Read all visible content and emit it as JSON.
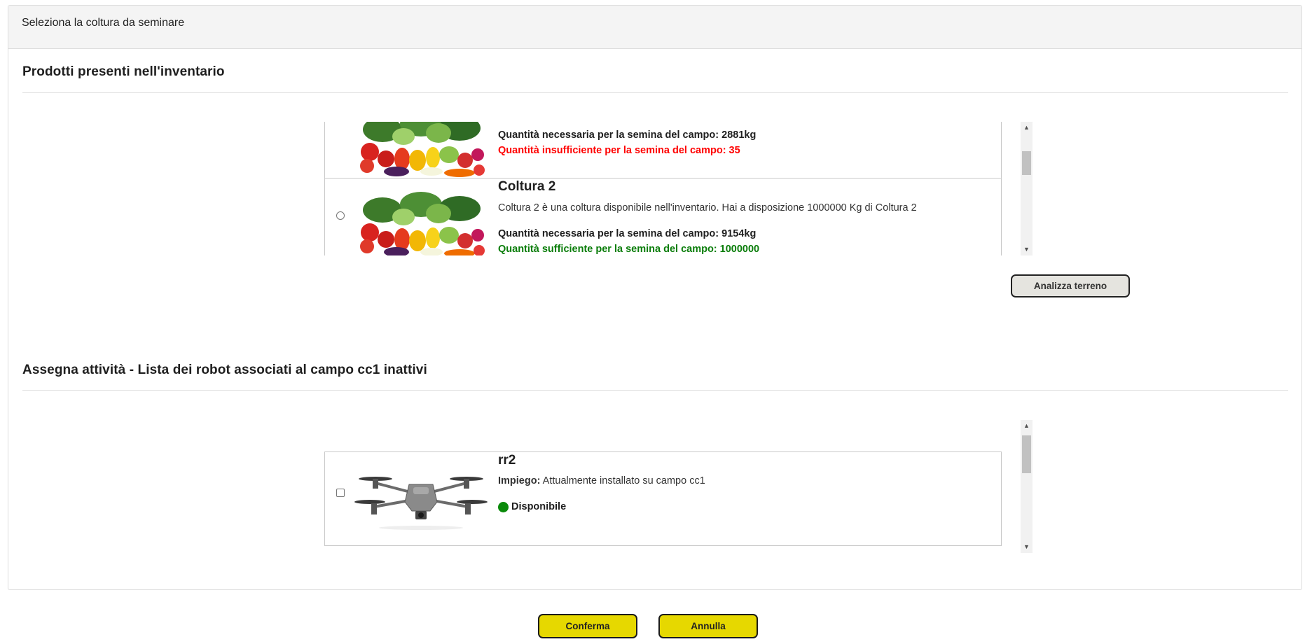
{
  "header": {
    "title": "Seleziona la coltura da seminare"
  },
  "inventory": {
    "title": "Prodotti presenti nell'inventario",
    "items": [
      {
        "name": "",
        "description": "",
        "qty_needed": "Quantità necessaria per la semina del campo: 2881kg",
        "availability": "Quantità insufficiente per la semina del campo: 35",
        "availability_color": "#ff0000"
      },
      {
        "name": "Coltura 2",
        "description": "Coltura 2 è una coltura disponibile nell'inventario. Hai a disposizione 1000000 Kg di Coltura 2",
        "qty_needed": "Quantità necessaria per la semina del campo: 9154kg",
        "availability": "Quantità sufficiente per la semina del campo: 1000000",
        "availability_color": "#0a7d0a"
      }
    ],
    "analyze_button": "Analizza terreno"
  },
  "robots": {
    "title": "Assegna attività - Lista dei robot associati al campo cc1 inattivi",
    "items": [
      {
        "name": "rr2",
        "usage_label": "Impiego:",
        "usage_value": " Attualmente installato su campo cc1",
        "status": "Disponibile",
        "status_color": "#0a8a0a"
      }
    ]
  },
  "footer": {
    "confirm": "Conferma",
    "cancel": "Annulla"
  },
  "colors": {
    "accent_yellow": "#e6d800",
    "bad": "#ff0000",
    "good": "#0a7d0a"
  }
}
